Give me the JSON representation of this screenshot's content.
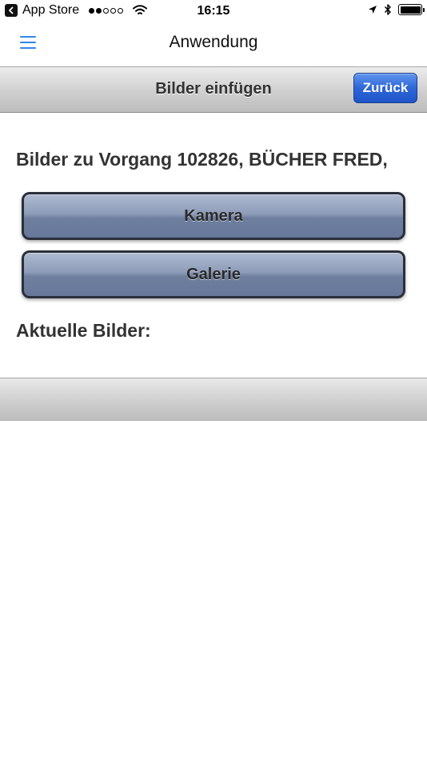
{
  "status_bar": {
    "back_app_label": "App Store",
    "time": "16:15",
    "signal_dots_filled": 2,
    "signal_dots_total": 5
  },
  "nav": {
    "title": "Anwendung",
    "menu_icon": "hamburger-menu-icon"
  },
  "header": {
    "title": "Bilder einfügen",
    "back_button_label": "Zurück"
  },
  "content": {
    "heading": "Bilder zu Vorgang 102826, BÜCHER FRED,",
    "camera_button_label": "Kamera",
    "gallery_button_label": "Galerie",
    "current_images_label": "Aktuelle Bilder:"
  },
  "colors": {
    "accent_blue": "#2f86e8",
    "back_button_blue": "#2f67d6",
    "action_button": "#8d9cb8"
  }
}
